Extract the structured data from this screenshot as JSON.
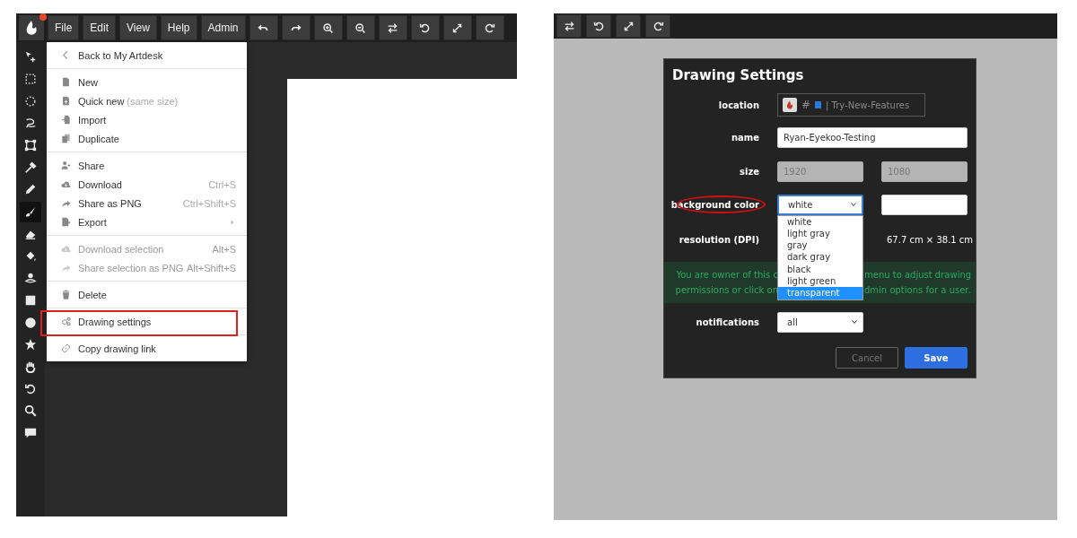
{
  "editor": {
    "menus": [
      "File",
      "Edit",
      "View",
      "Help",
      "Admin"
    ],
    "tools": [
      {
        "selected": false
      },
      {
        "selected": false
      },
      {
        "selected": false
      },
      {
        "selected": false
      },
      {
        "selected": false
      },
      {
        "selected": false
      },
      {
        "selected": false
      },
      {
        "selected": true
      },
      {
        "selected": false
      },
      {
        "selected": false
      },
      {
        "selected": false
      },
      {
        "selected": false
      },
      {
        "selected": false
      },
      {
        "selected": false
      },
      {
        "selected": false
      },
      {
        "selected": false
      },
      {
        "selected": false
      },
      {
        "selected": false
      }
    ],
    "file_menu": [
      [
        {
          "label": "Back to My Artdesk",
          "disabled": false,
          "submenu": false,
          "marked": false
        }
      ],
      [
        {
          "label": "New",
          "disabled": false,
          "submenu": false,
          "marked": false
        },
        {
          "label": "Quick new",
          "note": "(same size)",
          "disabled": false,
          "submenu": false,
          "marked": false
        },
        {
          "label": "Import",
          "disabled": false,
          "submenu": false,
          "marked": false
        },
        {
          "label": "Duplicate",
          "disabled": false,
          "submenu": false,
          "marked": false
        }
      ],
      [
        {
          "label": "Share",
          "disabled": false,
          "submenu": false,
          "marked": false
        },
        {
          "label": "Download",
          "shortcut": "Ctrl+S",
          "disabled": false,
          "submenu": false,
          "marked": false
        },
        {
          "label": "Share as PNG",
          "shortcut": "Ctrl+Shift+S",
          "disabled": false,
          "submenu": false,
          "marked": false
        },
        {
          "label": "Export",
          "disabled": false,
          "submenu": true,
          "marked": false
        }
      ],
      [
        {
          "label": "Download selection",
          "shortcut": "Alt+S",
          "disabled": true,
          "submenu": false,
          "marked": false
        },
        {
          "label": "Share selection as PNG",
          "shortcut": "Alt+Shift+S",
          "disabled": true,
          "submenu": false,
          "marked": false
        }
      ],
      [
        {
          "label": "Delete",
          "disabled": false,
          "submenu": false,
          "marked": false
        }
      ],
      [
        {
          "label": "Drawing settings",
          "disabled": false,
          "submenu": false,
          "marked": true
        }
      ],
      [
        {
          "label": "Copy drawing link",
          "disabled": false,
          "submenu": false,
          "marked": false
        }
      ]
    ]
  },
  "settings_dialog": {
    "title": "Drawing Settings",
    "fields": [
      {
        "kind": "location",
        "label": "location",
        "marked": false,
        "hash": "#",
        "value": "| Try-New-Features"
      },
      {
        "kind": "text",
        "label": "name",
        "marked": false,
        "value": "Ryan-Eyekoo-Testing"
      },
      {
        "kind": "pair",
        "label": "size",
        "marked": false,
        "disabled": true,
        "values": [
          "1920",
          "1080"
        ]
      },
      {
        "kind": "color",
        "label": "background color",
        "marked": true,
        "value": "white",
        "expanded": true,
        "options": [
          {
            "label": "white",
            "highlighted": false
          },
          {
            "label": "light gray",
            "highlighted": false
          },
          {
            "label": "gray",
            "highlighted": false
          },
          {
            "label": "dark gray",
            "highlighted": false
          },
          {
            "label": "black",
            "highlighted": false
          },
          {
            "label": "light green",
            "highlighted": false
          },
          {
            "label": "transparent",
            "highlighted": true
          }
        ]
      },
      {
        "kind": "reading",
        "label": "resolution (DPI)",
        "marked": false,
        "value": "67.7 cm × 38.1 cm"
      },
      {
        "kind": "message",
        "lines": [
          [
            "You are owner of this c",
            "menu to adjust drawing"
          ],
          [
            "permissions or click on",
            "dmin options for a user."
          ]
        ]
      },
      {
        "kind": "select",
        "label": "notifications",
        "marked": false,
        "value": "all"
      }
    ],
    "buttons": [
      {
        "label": "Cancel",
        "kind": "secondary"
      },
      {
        "label": "Save",
        "kind": "primary"
      }
    ]
  }
}
